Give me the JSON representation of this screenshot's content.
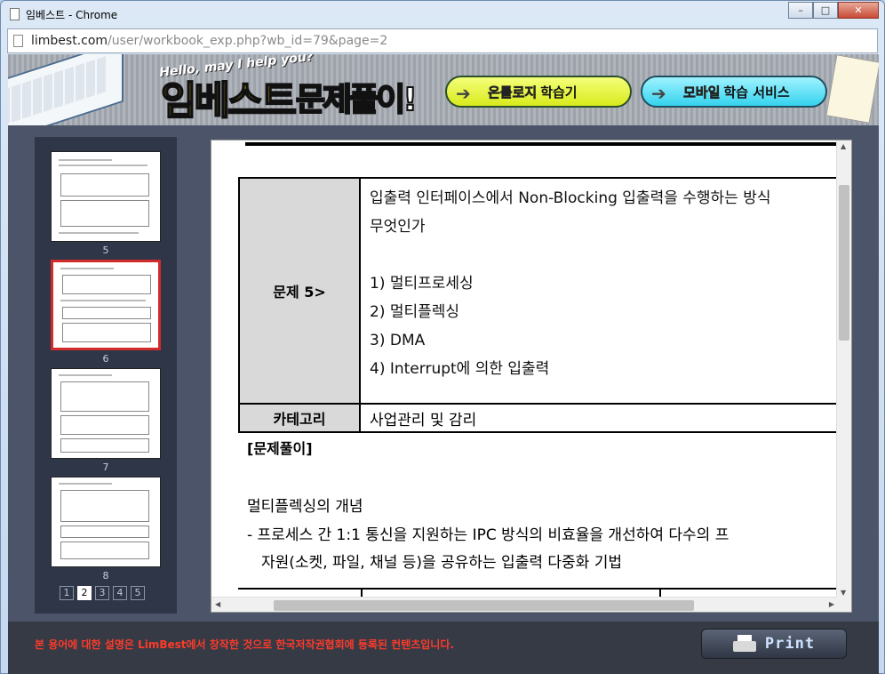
{
  "window": {
    "title": "임베스트 - Chrome",
    "buttons": {
      "minimize": "–",
      "maximize": "□",
      "close": "✕"
    }
  },
  "address": {
    "host": "limbest.com",
    "path": "/user/workbook_exp.php?wb_id=79&page=2"
  },
  "banner": {
    "hello": "Hello, may I help you?",
    "logo_a": "임베스트",
    "logo_b": "문제풀이!",
    "pill1_hl": "온톨로지",
    "pill1_text": "학습기",
    "pill2_hl": "모바일",
    "pill2_text": "학습 서비스"
  },
  "sidebar": {
    "thumbs": [
      {
        "num": "5",
        "active": false
      },
      {
        "num": "6",
        "active": true
      },
      {
        "num": "7",
        "active": false
      },
      {
        "num": "8",
        "active": false
      }
    ],
    "pages": [
      "1",
      "2",
      "3",
      "4",
      "5"
    ],
    "current_page": "2"
  },
  "question": {
    "label": "문제 5>",
    "text_line1": "입출력 인터페이스에서 Non-Blocking 입출력을 수행하는 방식",
    "text_line2": "무엇인가",
    "options": [
      "1) 멀티프로세싱",
      "2) 멀티플렉싱",
      "3) DMA",
      "4) Interrupt에 의한 입출력"
    ],
    "category_label": "카테고리",
    "category_value": "사업관리 및 감리"
  },
  "solution": {
    "heading": "[문제풀이]",
    "title": "멀티플렉싱의 개념",
    "line1": "- 프로세스 간 1:1 통신을 지원하는 IPC 방식의 비효율을 개선하여 다수의 프",
    "line2": "자원(소켓, 파일, 채널 등)을 공유하는 입출력 다중화 기법"
  },
  "footer": {
    "copyright": "본 용어에 대한 설명은 LimBest에서 창작한 것으로 한국저작권협회에 등록된 컨텐츠입니다.",
    "print_label": "Print"
  },
  "colors": {
    "active_thumb_border": "#d22b2b",
    "copyright_text": "#ff3a2a",
    "page_bg": "#4b5468"
  }
}
